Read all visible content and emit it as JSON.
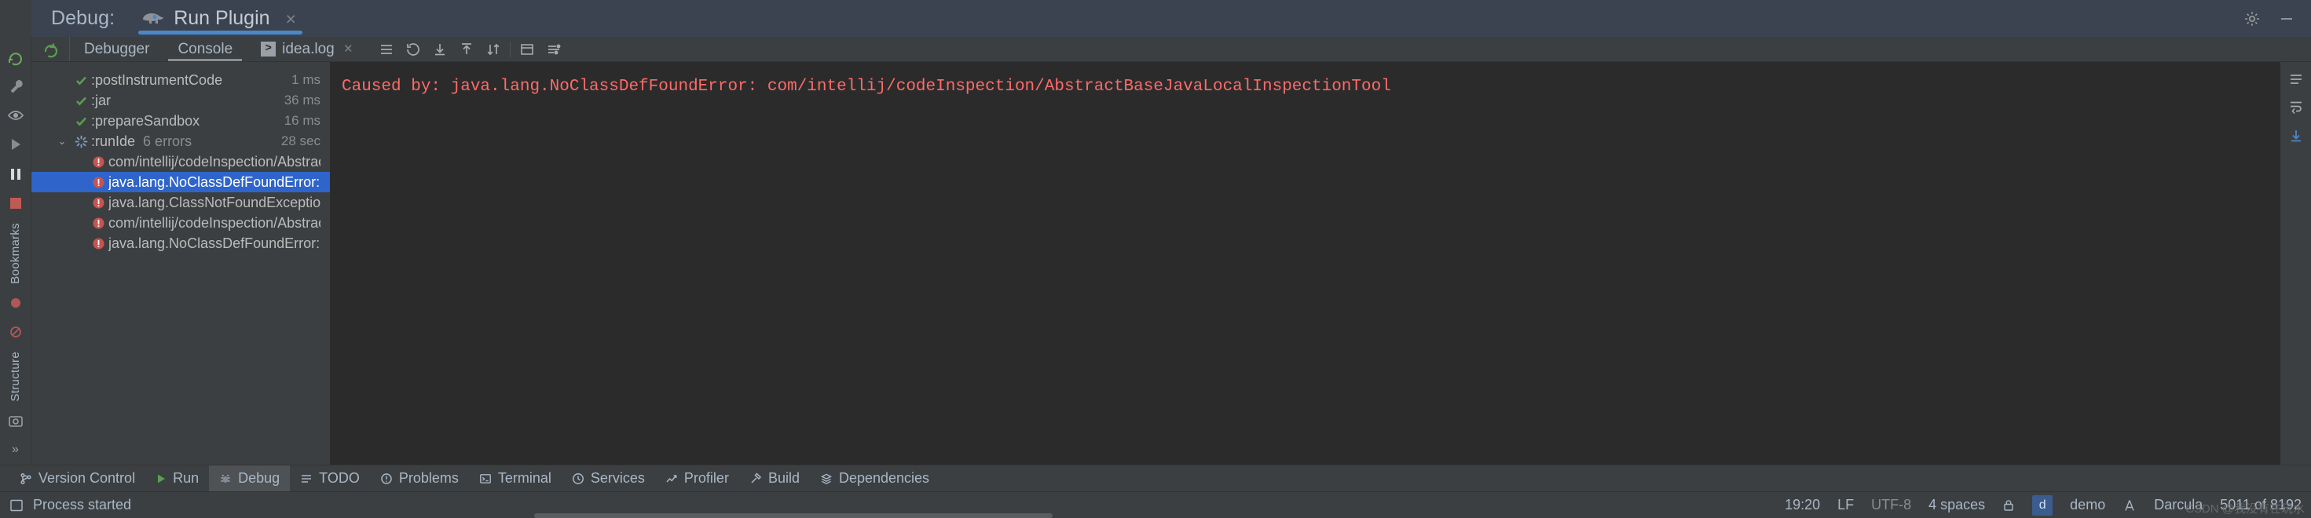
{
  "window": {
    "debug_label": "Debug:",
    "run_tab_title": "Run Plugin",
    "run_tab_icon": "gradle-elephant-icon",
    "close_glyph": "×",
    "settings_icon": "gear-icon",
    "hide_icon": "minimize-icon"
  },
  "subtabs": {
    "rerun_icon": "rerun-icon",
    "items": [
      {
        "label": "Debugger",
        "active": false
      },
      {
        "label": "Console",
        "active": true
      },
      {
        "label": "idea.log",
        "active": false,
        "icon": "console-log-icon",
        "closable": true
      }
    ],
    "toolbar": [
      {
        "name": "expand-collapse-icon",
        "glyph": "☰"
      },
      {
        "name": "rerun-failed-icon",
        "glyph": "↺"
      },
      {
        "name": "download-icon",
        "glyph": "↧"
      },
      {
        "name": "upload-icon",
        "glyph": "↥"
      },
      {
        "name": "sort-icon",
        "glyph": "↓↑"
      },
      {
        "name": "layout-icon",
        "glyph": "▤"
      },
      {
        "name": "settings-list-icon",
        "glyph": "≣"
      }
    ]
  },
  "leftstrip": {
    "items": [
      {
        "name": "gradle-icon",
        "glyph": "G"
      },
      {
        "name": "build-wrench-icon",
        "glyph": "🔧"
      },
      {
        "name": "watch-eye-icon",
        "glyph": "◉"
      },
      {
        "name": "step-over-icon",
        "glyph": "▷"
      },
      {
        "name": "pause-icon",
        "glyph": "‖"
      },
      {
        "name": "stop-icon",
        "glyph": "■"
      },
      {
        "name": "bookmarks-label",
        "glyph": "Bookmarks",
        "vertical": true
      },
      {
        "name": "mute-breakpoints-icon",
        "glyph": "●"
      },
      {
        "name": "breakpoint-off-icon",
        "glyph": "⊘"
      },
      {
        "name": "structure-label",
        "glyph": "Structure",
        "vertical": true
      },
      {
        "name": "camera-icon",
        "glyph": "▣"
      },
      {
        "name": "more-icon",
        "glyph": "»"
      }
    ]
  },
  "tree": {
    "rows": [
      {
        "indent": 1,
        "state": "ok",
        "twisty": "",
        "label": ":postInstrumentCode",
        "sub": "",
        "time": "1 ms",
        "selected": false
      },
      {
        "indent": 1,
        "state": "ok",
        "twisty": "",
        "label": ":jar",
        "sub": "",
        "time": "36 ms",
        "selected": false
      },
      {
        "indent": 1,
        "state": "ok",
        "twisty": "",
        "label": ":prepareSandbox",
        "sub": "",
        "time": "16 ms",
        "selected": false
      },
      {
        "indent": 0,
        "state": "running",
        "twisty": "⌄",
        "label": ":runIde",
        "sub": "6 errors",
        "time": "28 sec",
        "selected": false
      },
      {
        "indent": 2,
        "state": "error",
        "twisty": "",
        "label": "com/intellij/codeInspection/AbstractBaseJavaLocalIns",
        "sub": "",
        "time": "",
        "selected": false
      },
      {
        "indent": 2,
        "state": "error",
        "twisty": "",
        "label": "java.lang.NoClassDefFoundError: com/intellij/codeInsp",
        "sub": "",
        "time": "",
        "selected": true
      },
      {
        "indent": 2,
        "state": "error",
        "twisty": "",
        "label": "java.lang.ClassNotFoundException: com.intellij.codeIn",
        "sub": "",
        "time": "",
        "selected": false
      },
      {
        "indent": 2,
        "state": "error",
        "twisty": "",
        "label": "com/intellij/codeInspection/AbstractBaseJavaLocalIns",
        "sub": "",
        "time": "",
        "selected": false
      },
      {
        "indent": 2,
        "state": "error",
        "twisty": "",
        "label": "java.lang.NoClassDefFoundError: com/intellij/codeInsp",
        "sub": "",
        "time": "",
        "selected": false
      }
    ]
  },
  "console": {
    "line": "Caused by: java.lang.NoClassDefFoundError: com/intellij/codeInspection/AbstractBaseJavaLocalInspectionTool",
    "error_color": "#ff6b68",
    "rail": [
      {
        "name": "settings-rail-icon",
        "glyph": "≡"
      },
      {
        "name": "wrap-text-icon",
        "glyph": "↵"
      },
      {
        "name": "scroll-end-icon",
        "glyph": "↧",
        "accent": true
      }
    ]
  },
  "bottom_tabs": {
    "items": [
      {
        "label": "Version Control",
        "icon": "branch-icon",
        "active": false
      },
      {
        "label": "Run",
        "icon": "run-play-icon",
        "active": false
      },
      {
        "label": "Debug",
        "icon": "debug-bug-icon",
        "active": true
      },
      {
        "label": "TODO",
        "icon": "todo-list-icon",
        "active": false
      },
      {
        "label": "Problems",
        "icon": "problems-icon",
        "active": false
      },
      {
        "label": "Terminal",
        "icon": "terminal-icon",
        "active": false
      },
      {
        "label": "Services",
        "icon": "services-icon",
        "active": false
      },
      {
        "label": "Profiler",
        "icon": "profiler-icon",
        "active": false
      },
      {
        "label": "Build",
        "icon": "build-hammer-icon",
        "active": false
      },
      {
        "label": "Dependencies",
        "icon": "dependencies-icon",
        "active": false
      }
    ]
  },
  "statusbar": {
    "left_icon": "terminal-square-icon",
    "message": "Process started",
    "time": "19:20",
    "line_separator": "LF",
    "encoding": "UTF-8",
    "indent": "4 spaces",
    "lock_icon": "lock-icon",
    "project_badge": "d",
    "project_name": "demo",
    "theme_icon": "theme-icon",
    "theme_name": "Darcula",
    "memory": "5011 of 8192",
    "watermark": "CSDN @我没有在玩水"
  }
}
